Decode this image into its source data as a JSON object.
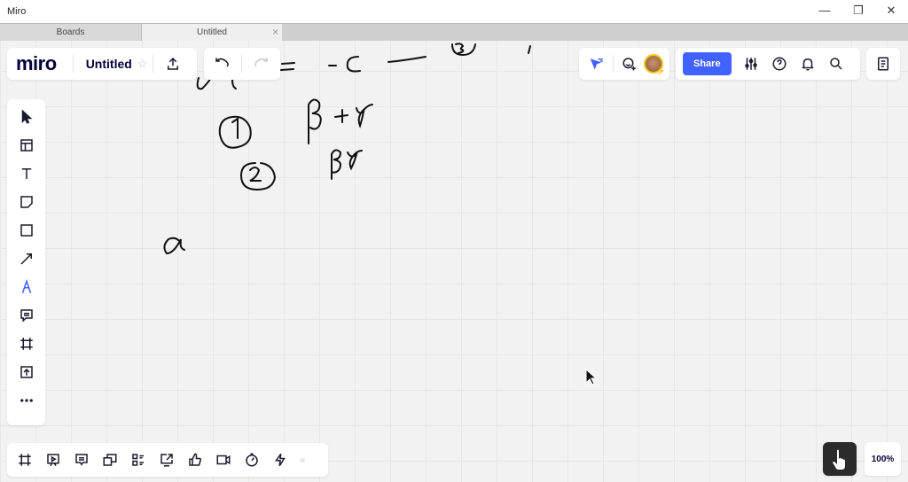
{
  "window": {
    "title": "Miro",
    "minimize": "—",
    "restore": "❐",
    "close": "✕"
  },
  "tabs": [
    {
      "label": "Boards"
    },
    {
      "label": "Untitled",
      "close": "×"
    }
  ],
  "header": {
    "logo": "miro",
    "board_name": "Untitled",
    "star": "☆",
    "share_label": "Share"
  },
  "zoom": {
    "level": "100%"
  },
  "collapse": "«",
  "colors": {
    "accent": "#4262ff",
    "ink": "#050038",
    "canvas": "#f2f2f2"
  }
}
